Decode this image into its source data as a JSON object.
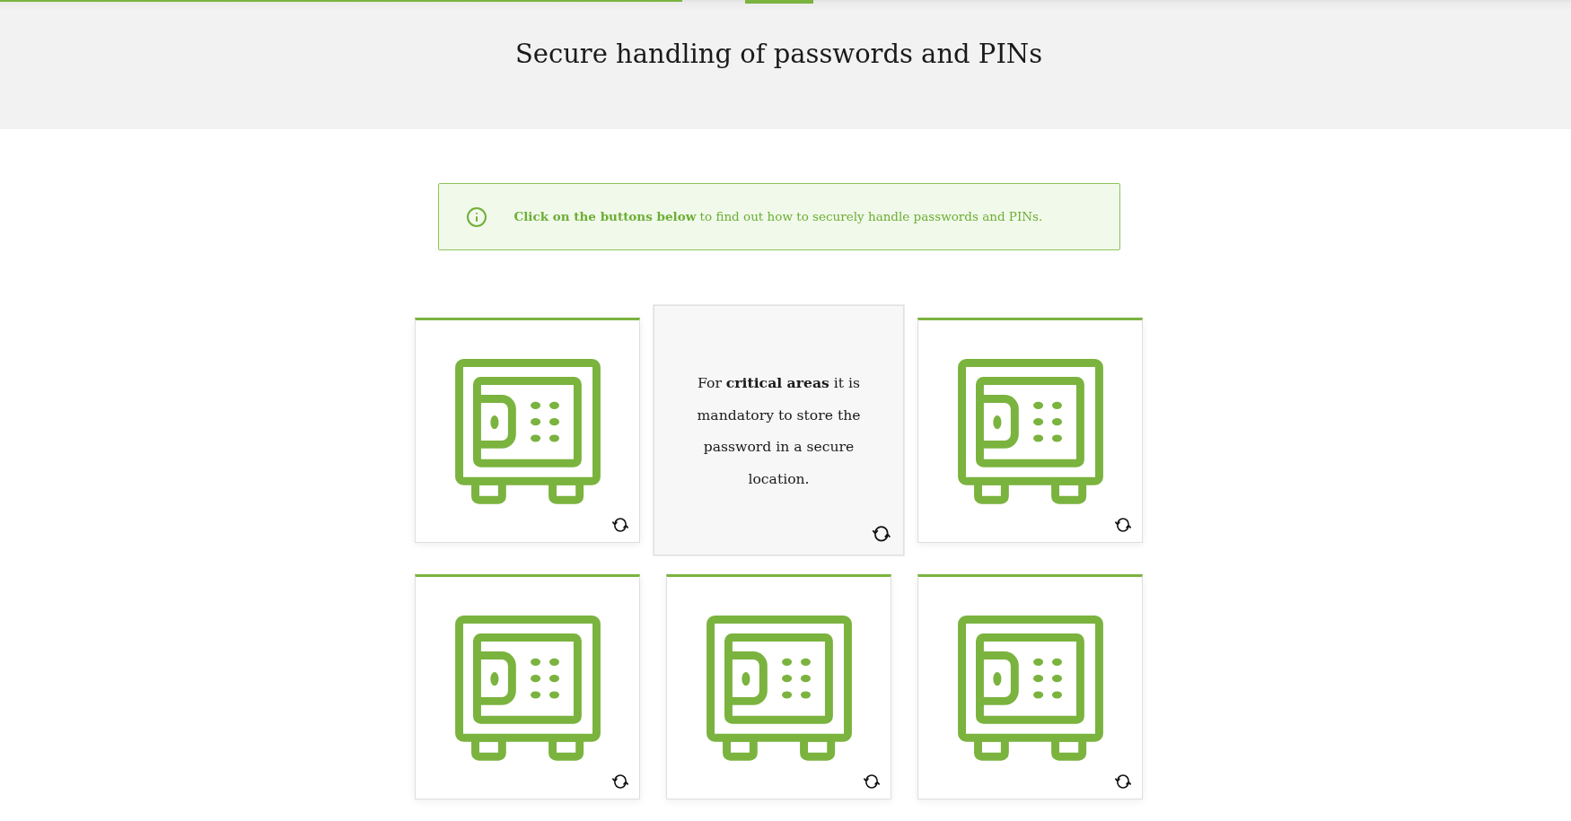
{
  "progress": {
    "level": 0.434
  },
  "header": {
    "title": "Secure handling of passwords and PINs"
  },
  "info": {
    "text": "**Click on the buttons below** to find out how to securely handle passwords and PINs."
  },
  "cards": [
    {
      "flipped": false
    },
    {
      "flipped": true,
      "text": "For **critical areas** it is mandatory to store the password in a secure location."
    },
    {
      "flipped": false
    },
    {
      "flipped": false
    },
    {
      "flipped": false
    },
    {
      "flipped": false
    }
  ]
}
